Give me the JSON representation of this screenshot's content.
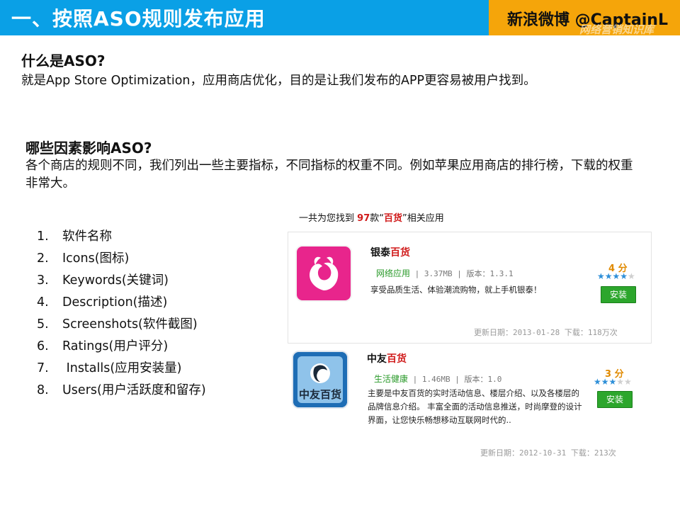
{
  "header": {
    "title": "一、按照ASO规则发布应用",
    "brand": "新浪微博 @CaptainL",
    "watermark": "网络营销知识库",
    "colors": {
      "left": "#0aa0e6",
      "right": "#f5a50a"
    }
  },
  "section1": {
    "question": "什么是ASO?",
    "answer": "就是App Store Optimization，应用商店优化，目的是让我们发布的APP更容易被用户找到。"
  },
  "section2": {
    "question": "哪些因素影响ASO?",
    "answer": "各个商店的规则不同，我们列出一些主要指标，不同指标的权重不同。例如苹果应用商店的排行榜，下载的权重非常大。"
  },
  "factors": [
    {
      "num": "1.",
      "label": "软件名称"
    },
    {
      "num": "2.",
      "label": "Icons(图标)"
    },
    {
      "num": "3.",
      "label": "Keywords(关键词)"
    },
    {
      "num": "4.",
      "label": "Description(描述)"
    },
    {
      "num": "5.",
      "label": "Screenshots(软件截图)"
    },
    {
      "num": "6.",
      "label": "Ratings(用户评分)"
    },
    {
      "num": "7.",
      "label": " Installs(应用安装量)"
    },
    {
      "num": "8.",
      "label": "Users(用户活跃度和留存)"
    }
  ],
  "search": {
    "prefix": "一共为您找到",
    "count": "97",
    "mid": "款“",
    "keyword": "百货",
    "suffix": "”相关应用"
  },
  "apps": [
    {
      "name_plain": "银泰",
      "name_highlight": "百货",
      "category": "网络应用",
      "size": "3.37MB",
      "version": "版本：1.3.1",
      "description": "享受品质生活、体验潮流购物，就上手机银泰！",
      "score": "4 分",
      "stars_on": "★★★★",
      "stars_off": "★",
      "rating": 4,
      "install_label": "安装",
      "updated": "更新日期：2013-01-28 下载：118万次",
      "icon_color": "#e8258c",
      "icon_name": "yintai-app-icon"
    },
    {
      "name_plain": "中友",
      "name_highlight": "百货",
      "category": "生活健康",
      "size": "1.46MB",
      "version": "版本：1.0",
      "description": "主要是中友百货的实时活动信息、楼层介绍、以及各楼层的品牌信息介绍。 丰富全面的活动信息推送，时尚摩登的设计界面，让您快乐畅想移动互联网时代的..",
      "score": "3 分",
      "stars_on": "★★★",
      "stars_off": "★★",
      "rating": 3,
      "install_label": "安装",
      "updated": "更新日期：2012-10-31 下载：213次",
      "icon_text": "中友百货",
      "icon_color": "#1e6db5",
      "icon_name": "zhongyou-app-icon"
    }
  ]
}
